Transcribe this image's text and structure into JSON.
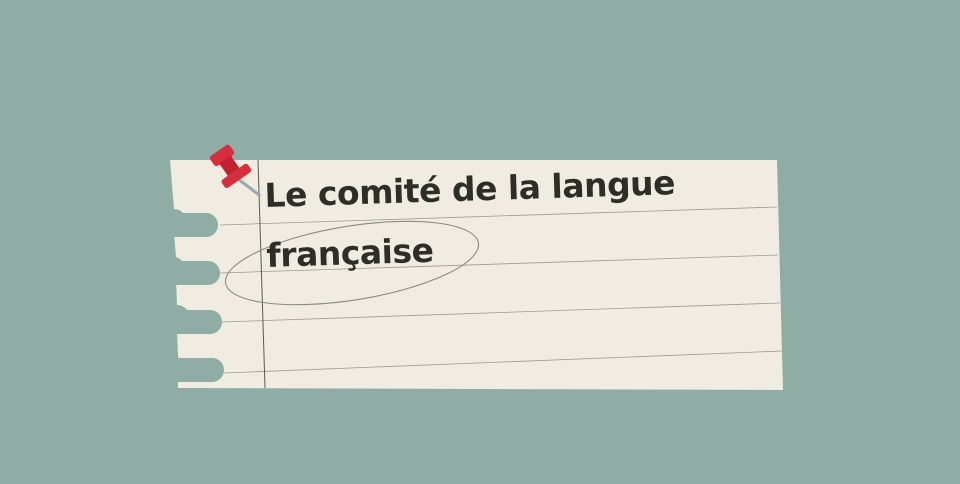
{
  "note": {
    "line1": "Le comité de la langue",
    "line2": "française"
  },
  "colors": {
    "background": "#8faca5",
    "paper": "#f0ece2",
    "rule_line": "#9a9a94",
    "margin_line": "#5a5a55",
    "pin": "#d62e3c",
    "text": "#2e2e28"
  },
  "icons": [
    "push-pin-icon"
  ]
}
